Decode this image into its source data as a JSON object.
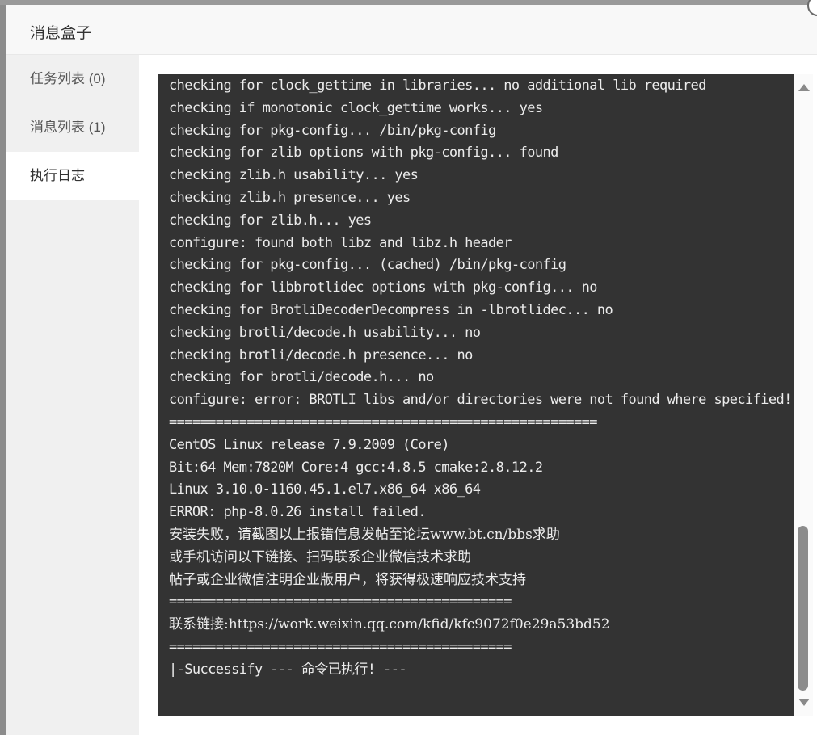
{
  "dialog": {
    "title": "消息盒子"
  },
  "sidebar": {
    "tabs": [
      {
        "label": "任务列表 (0)",
        "active": false
      },
      {
        "label": "消息列表 (1)",
        "active": false
      },
      {
        "label": "执行日志",
        "active": true
      }
    ]
  },
  "log": {
    "lines": [
      "checking for clock_gettime in libraries... no additional lib required",
      "checking if monotonic clock_gettime works... yes",
      "checking for pkg-config... /bin/pkg-config",
      "checking for zlib options with pkg-config... found",
      "checking zlib.h usability... yes",
      "checking zlib.h presence... yes",
      "checking for zlib.h... yes",
      "configure: found both libz and libz.h header",
      "checking for pkg-config... (cached) /bin/pkg-config",
      "checking for libbrotlidec options with pkg-config... no",
      "checking for BrotliDecoderDecompress in -lbrotlidec... no",
      "checking brotli/decode.h usability... no",
      "checking brotli/decode.h presence... no",
      "checking for brotli/decode.h... no",
      "configure: error: BROTLI libs and/or directories were not found where specified!",
      "=======================================================",
      "CentOS Linux release 7.9.2009 (Core)",
      "Bit:64 Mem:7820M Core:4 gcc:4.8.5 cmake:2.8.12.2",
      "Linux 3.10.0-1160.45.1.el7.x86_64 x86_64",
      "ERROR: php-8.0.26 install failed.",
      "安装失败，请截图以上报错信息发帖至论坛www.bt.cn/bbs求助",
      "或手机访问以下链接、扫码联系企业微信技术求助",
      "帖子或企业微信注明企业版用户，将获得极速响应技术支持",
      "============================================",
      "联系链接:https://work.weixin.qq.com/kfid/kfc9072f0e29a53bd52",
      "============================================",
      "|-Successify --- 命令已执行! ---"
    ]
  },
  "scrollbar": {
    "position_fraction": 1.0
  }
}
